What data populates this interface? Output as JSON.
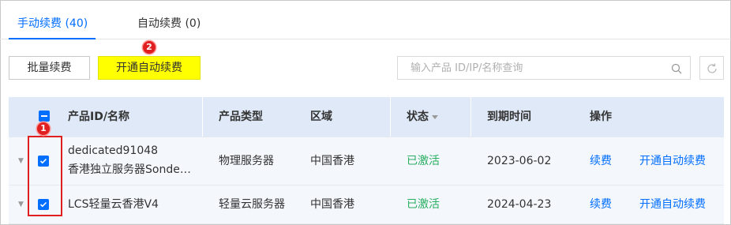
{
  "tabs": [
    {
      "label": "手动续费 (40)",
      "active": true
    },
    {
      "label": "自动续费 (0)",
      "active": false
    }
  ],
  "toolbar": {
    "batch_renew_label": "批量续费",
    "enable_auto_renew_label": "开通自动续费",
    "search_placeholder": "输入产品 ID/IP/名称查询"
  },
  "markers": {
    "m1": "1",
    "m2": "2"
  },
  "table": {
    "headers": {
      "product": "产品ID/名称",
      "type": "产品类型",
      "region": "区域",
      "status": "状态",
      "expiry": "到期时间",
      "actions": "操作"
    },
    "rows": [
      {
        "id": "dedicated91048",
        "name": "香港独立服务器Sonde…",
        "type": "物理服务器",
        "region": "中国香港",
        "status": "已激活",
        "expiry": "2023-06-02",
        "renew": "续费",
        "auto_renew": "开通自动续费",
        "checked": true
      },
      {
        "id": "LCS轻量云香港V4",
        "type": "轻量云服务器",
        "region": "中国香港",
        "status": "已激活",
        "expiry": "2024-04-23",
        "renew": "续费",
        "auto_renew": "开通自动续费",
        "checked": true
      }
    ]
  },
  "colors": {
    "accent": "#006eff",
    "status_active": "#27ae60",
    "highlight": "#e02020",
    "header_bg": "#dfe9f7"
  }
}
